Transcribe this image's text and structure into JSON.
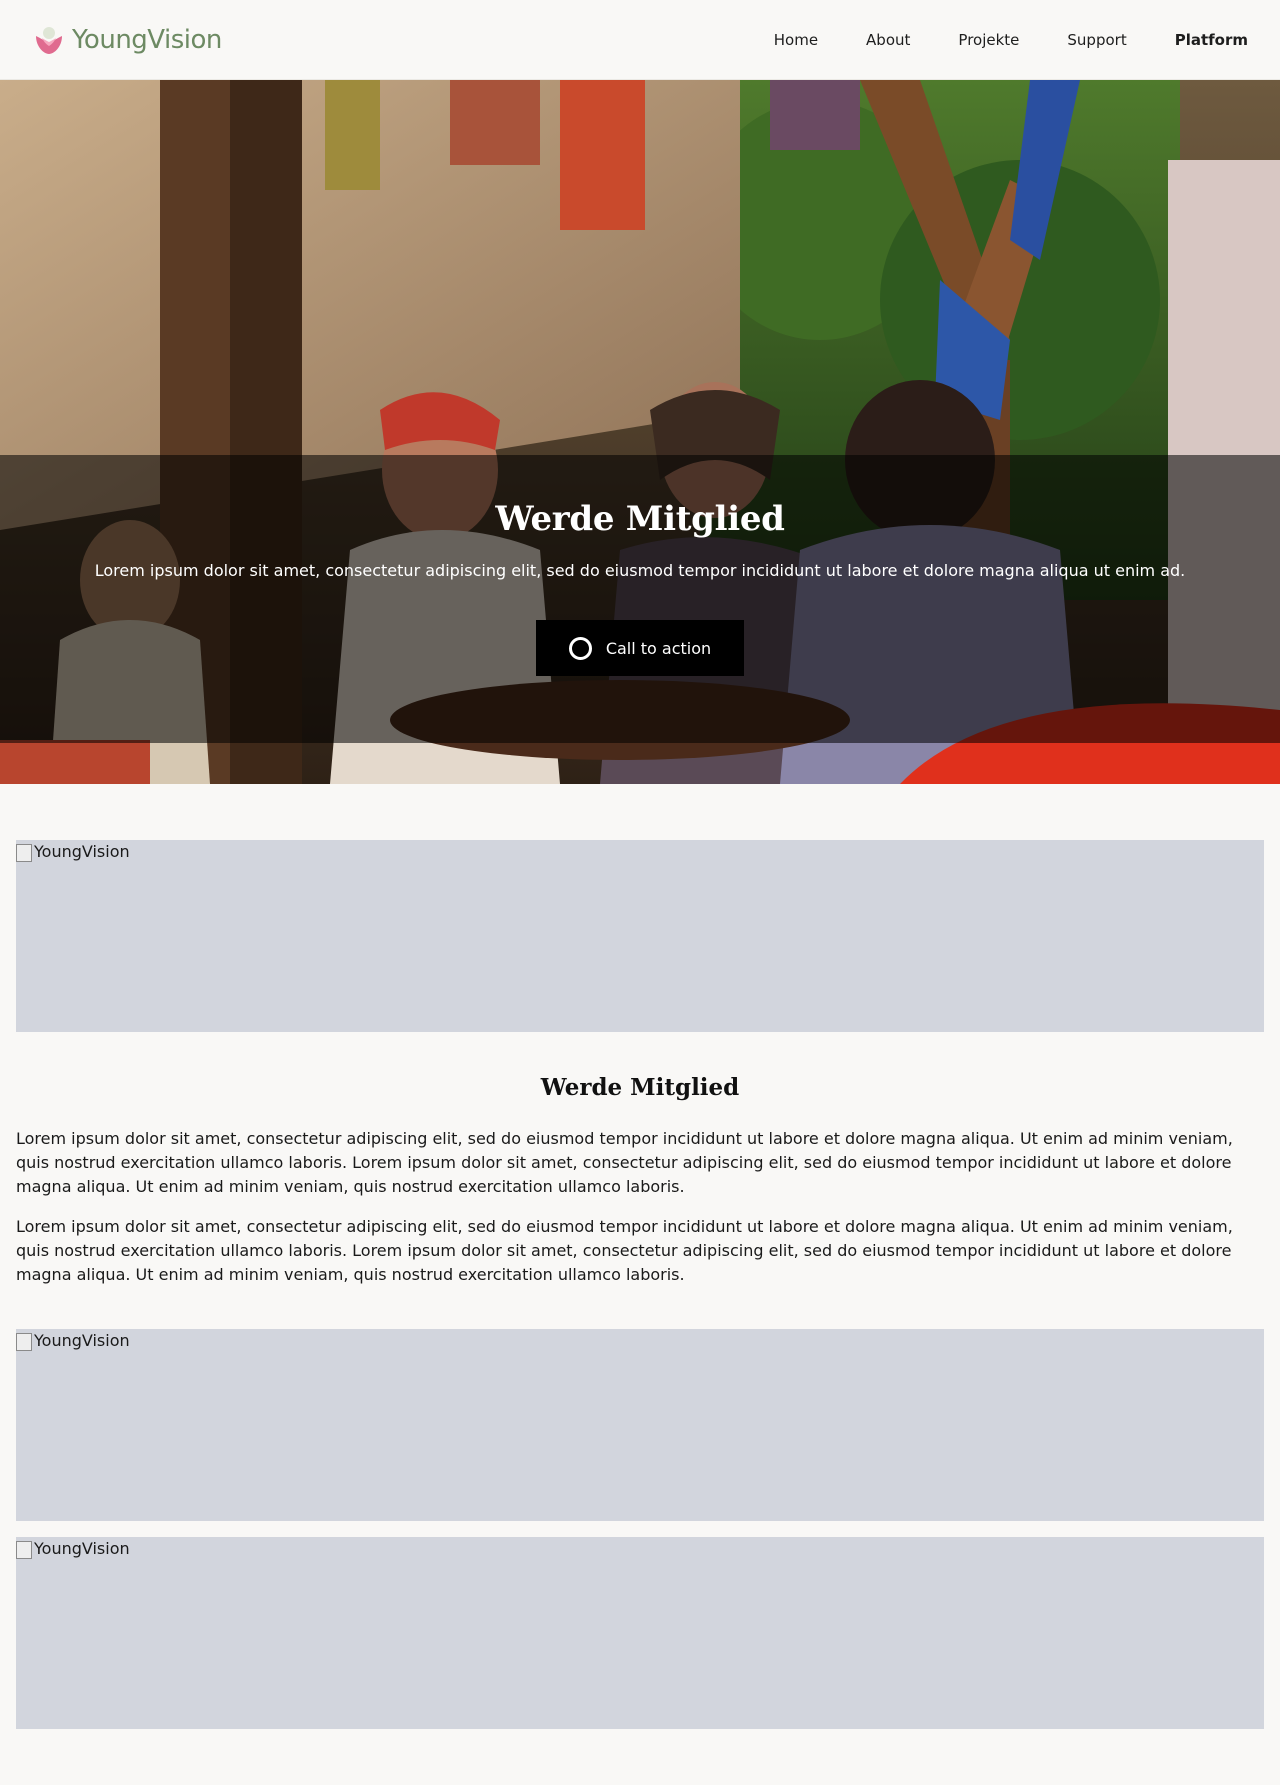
{
  "header": {
    "brand": "YoungVision",
    "nav": [
      {
        "label": "Home"
      },
      {
        "label": "About"
      },
      {
        "label": "Projekte"
      },
      {
        "label": "Support"
      },
      {
        "label": "Platform"
      }
    ]
  },
  "hero": {
    "title": "Werde Mitglied",
    "text": "Lorem ipsum dolor sit amet, consectetur adipiscing elit, sed do eiusmod tempor incididunt ut labore et dolore magna aliqua ut enim ad.",
    "cta_label": "Call to action"
  },
  "content": {
    "images": [
      {
        "alt": "YoungVision"
      },
      {
        "alt": "YoungVision"
      },
      {
        "alt": "YoungVision"
      }
    ],
    "title": "Werde Mitglied",
    "paragraphs": [
      "Lorem ipsum dolor sit amet, consectetur adipiscing elit, sed do eiusmod tempor incididunt ut labore et dolore magna aliqua. Ut enim ad minim veniam, quis nostrud exercitation ullamco laboris. Lorem ipsum dolor sit amet, consectetur adipiscing elit, sed do eiusmod tempor incididunt ut labore et dolore magna aliqua. Ut enim ad minim veniam, quis nostrud exercitation ullamco laboris.",
      "Lorem ipsum dolor sit amet, consectetur adipiscing elit, sed do eiusmod tempor incididunt ut labore et dolore magna aliqua. Ut enim ad minim veniam, quis nostrud exercitation ullamco laboris. Lorem ipsum dolor sit amet, consectetur adipiscing elit, sed do eiusmod tempor incididunt ut labore et dolore magna aliqua. Ut enim ad minim veniam, quis nostrud exercitation ullamco laboris."
    ]
  },
  "colors": {
    "brand_green": "#6d8a63",
    "brand_pink": "#e06b8f",
    "background": "#f9f8f6",
    "placeholder_gray": "#d2d5dd",
    "cta_black": "#000000"
  },
  "icons": {
    "logo": "heart-logo-icon",
    "cta": "circle-icon"
  }
}
